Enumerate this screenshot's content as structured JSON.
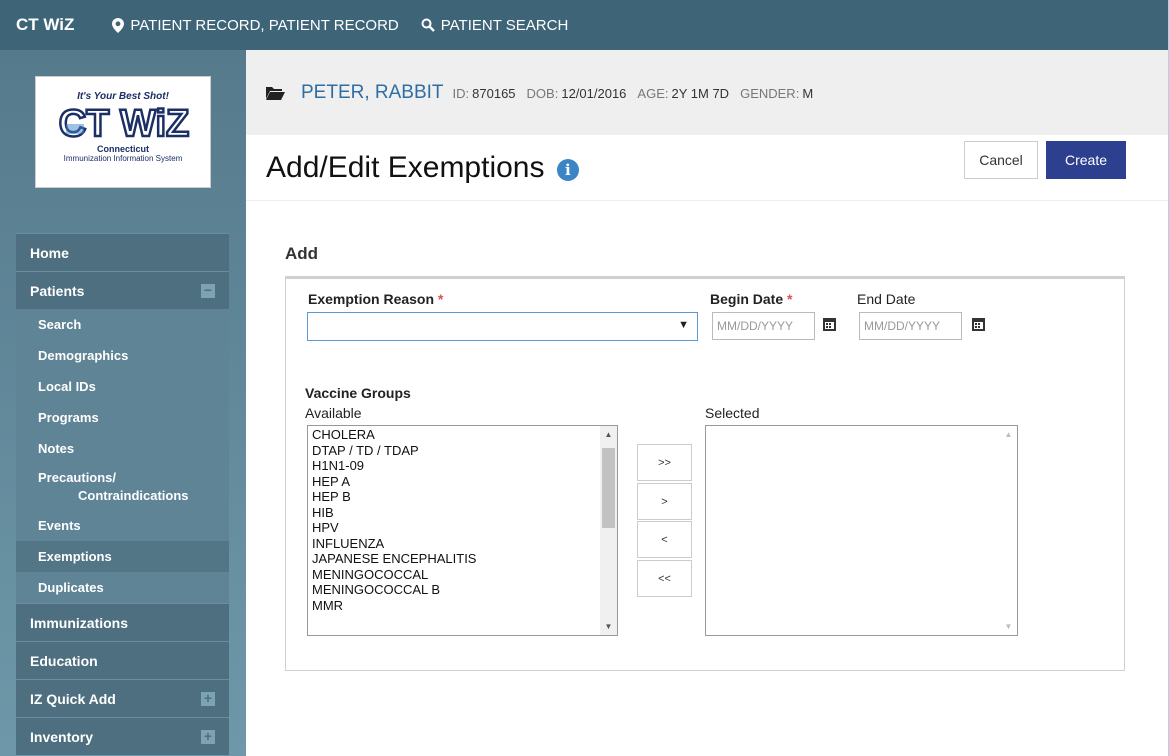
{
  "topbar": {
    "brand": "CT WiZ",
    "nav": [
      {
        "icon": "map-marker-icon",
        "label": "PATIENT RECORD, PATIENT RECORD"
      },
      {
        "icon": "search-icon",
        "label": "PATIENT SEARCH"
      }
    ]
  },
  "logo": {
    "tagline": "It's Your Best Shot!",
    "text": "CT WiZ",
    "sub1": "Connecticut",
    "sub2": "Immunization Information System"
  },
  "sidebar": {
    "home": "Home",
    "patients": "Patients",
    "patients_toggle": "−",
    "patient_items": [
      "Search",
      "Demographics",
      "Local IDs",
      "Programs",
      "Notes"
    ],
    "precautions_line1": "Precautions/",
    "precautions_line2": "Contraindications",
    "patient_items_after": [
      "Events",
      "Exemptions",
      "Duplicates"
    ],
    "active_item": "Exemptions",
    "immunizations": "Immunizations",
    "education": "Education",
    "iz_quick_add": "IZ Quick Add",
    "inventory": "Inventory",
    "expand_toggle": "+"
  },
  "patient": {
    "icon": "folder-open-icon",
    "name": "PETER, RABBIT",
    "id_label": "ID:",
    "id": "870165",
    "dob_label": "DOB:",
    "dob": "12/01/2016",
    "age_label": "AGE:",
    "age": "2Y 1M 7D",
    "gender_label": "GENDER:",
    "gender": "M"
  },
  "page": {
    "title": "Add/Edit Exemptions",
    "info_icon": "i",
    "cancel_label": "Cancel",
    "create_label": "Create"
  },
  "form": {
    "section": "Add",
    "exemption_reason_label": "Exemption Reason",
    "required_mark": "*",
    "exemption_reason_value": "",
    "begin_date_label": "Begin Date",
    "end_date_label": "End Date",
    "begin_date_placeholder": "MM/DD/YYYY",
    "end_date_placeholder": "MM/DD/YYYY",
    "vaccine_groups_label": "Vaccine Groups",
    "available_label": "Available",
    "selected_label": "Selected",
    "available_items": [
      "CHOLERA",
      "DTAP / TD / TDAP",
      "H1N1-09",
      "HEP A",
      "HEP B",
      "HIB",
      "HPV",
      "INFLUENZA",
      "JAPANESE ENCEPHALITIS",
      "MENINGOCOCCAL",
      "MENINGOCOCCAL B",
      "MMR"
    ],
    "selected_items": [],
    "move_all_right": ">>",
    "move_right": ">",
    "move_left": "<",
    "move_all_left": "<<"
  }
}
